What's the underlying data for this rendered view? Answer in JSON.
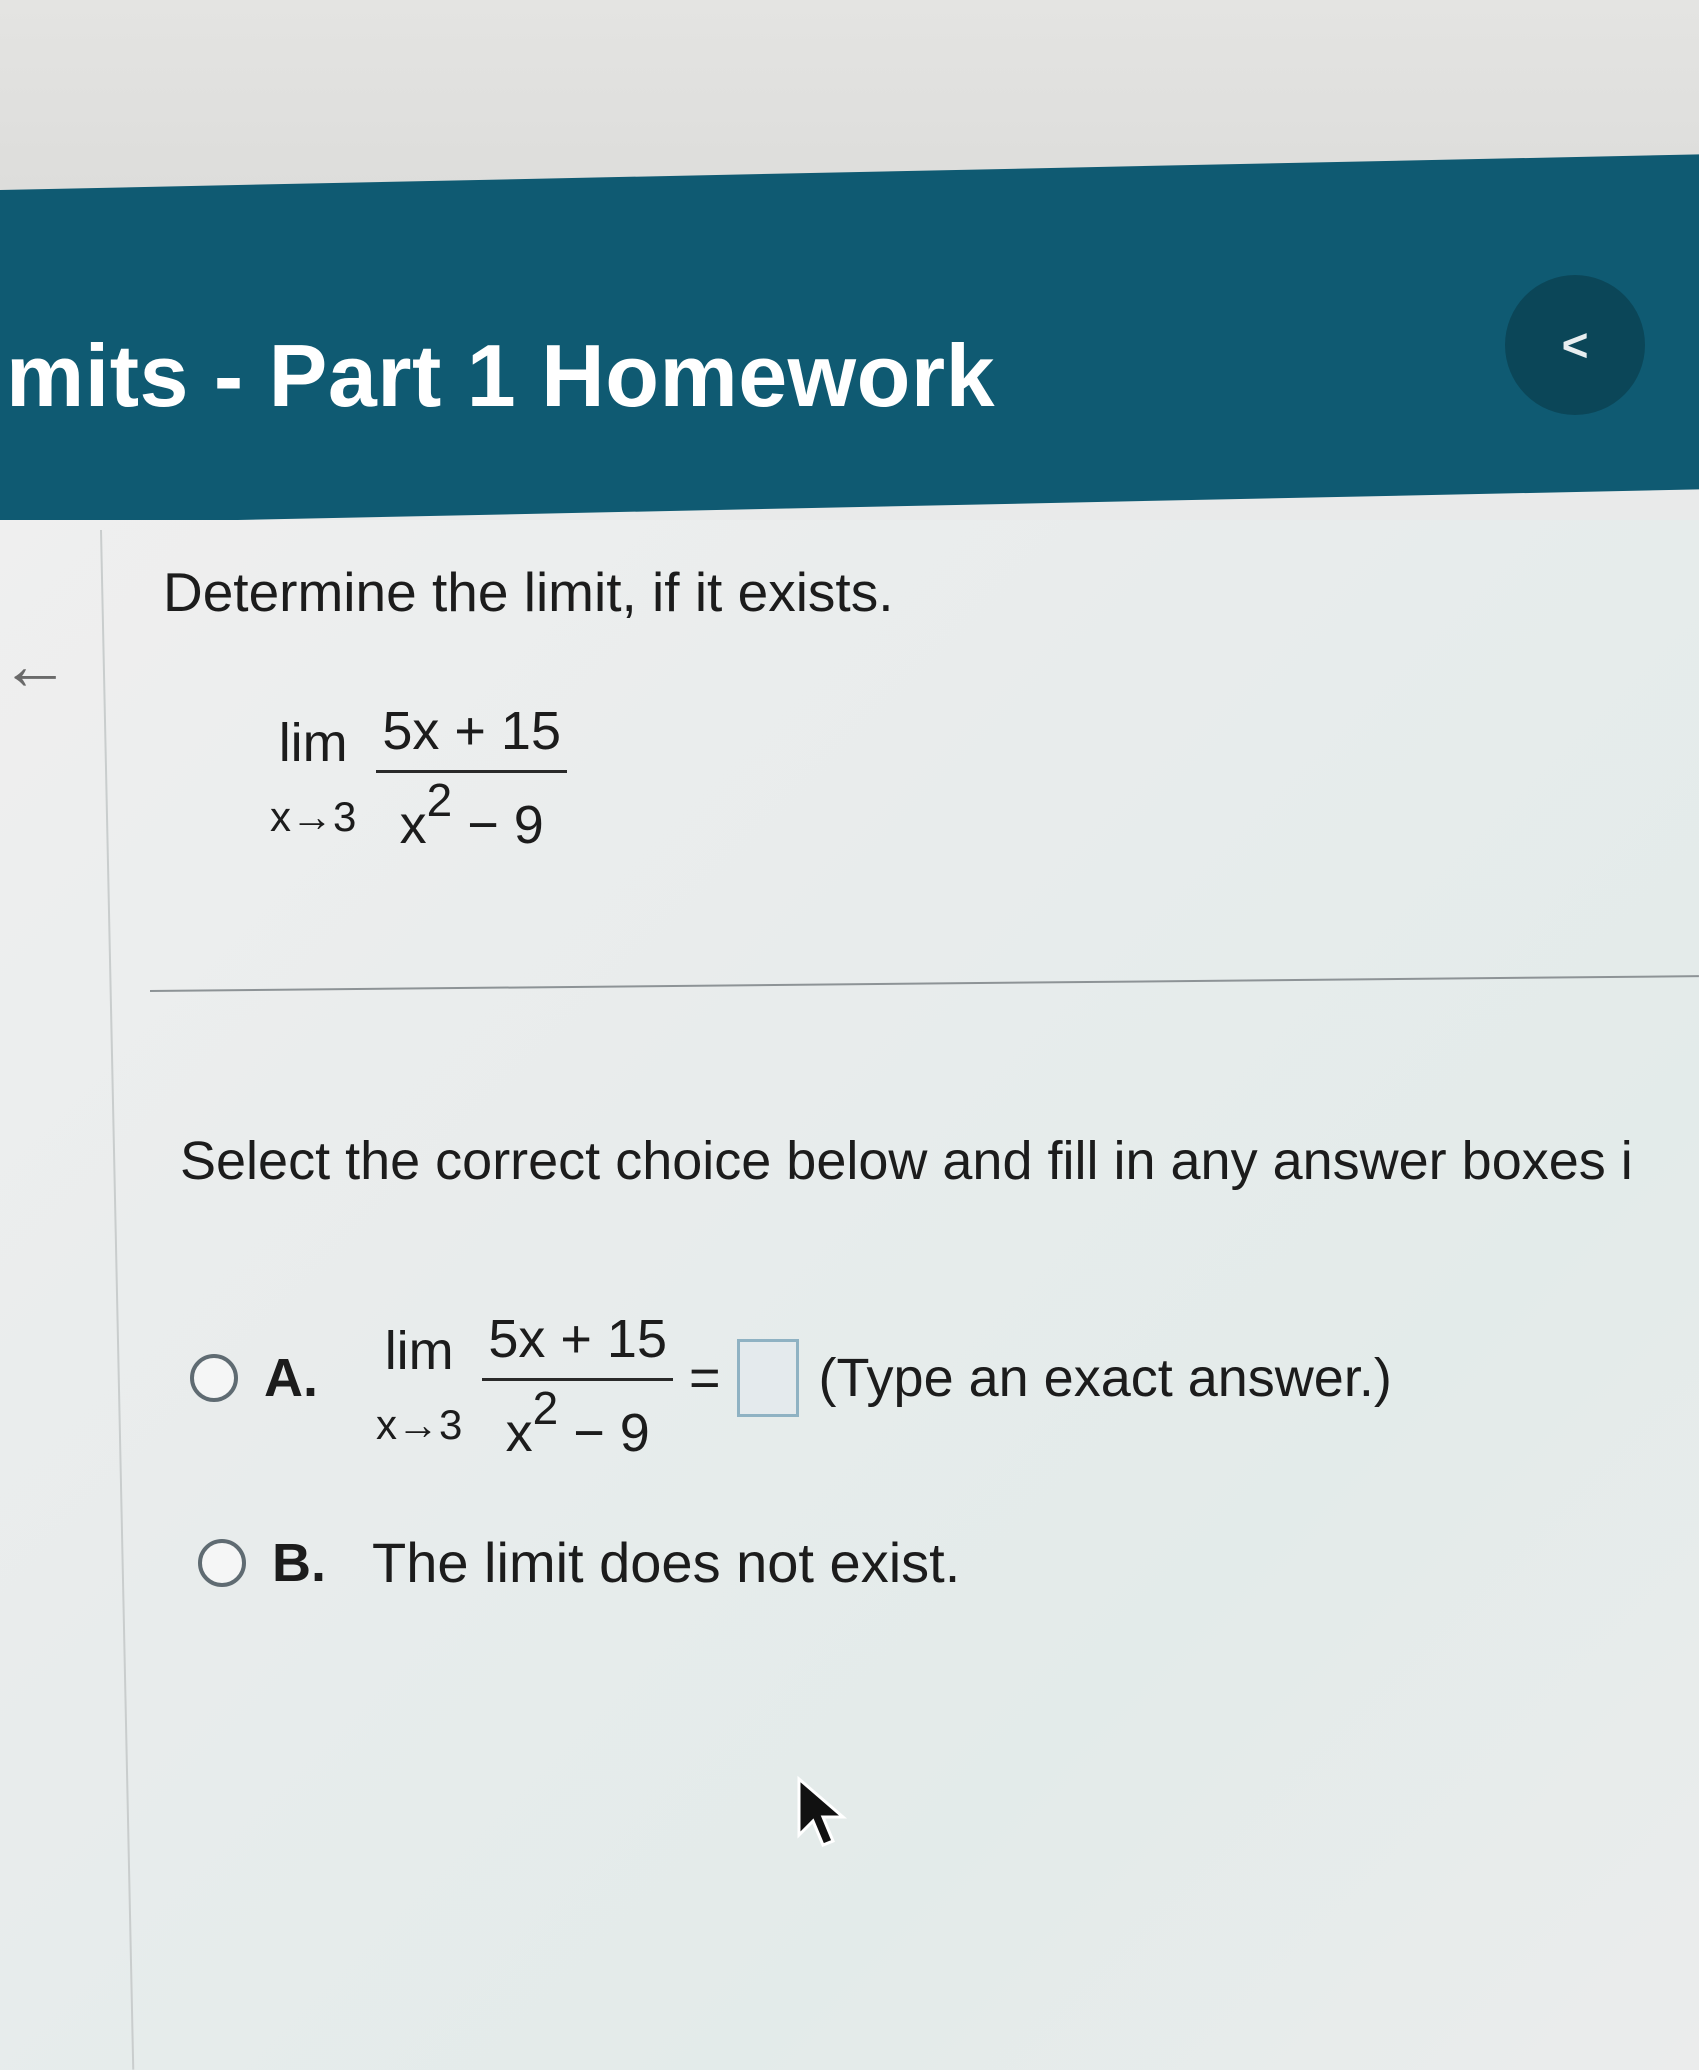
{
  "header": {
    "title": "mits - Part 1 Homework",
    "back_icon": "chevron-left-icon",
    "back_glyph": "<"
  },
  "side": {
    "collapse_glyph": "←"
  },
  "question": {
    "prompt": "Determine the limit, if it exists.",
    "expression": {
      "lim": "lim",
      "approach": "x→3",
      "numerator": "5x + 15",
      "denominator_base": "x",
      "denominator_exp": "2",
      "denominator_rest": " − 9"
    }
  },
  "instructions": "Select the correct choice below and fill in any answer boxes i",
  "choices": [
    {
      "letter": "A.",
      "expression": {
        "lim": "lim",
        "approach": "x→3",
        "numerator": "5x + 15",
        "denominator_base": "x",
        "denominator_exp": "2",
        "denominator_rest": " − 9"
      },
      "equals": "=",
      "answer_value": "",
      "hint": "(Type an exact answer.)"
    },
    {
      "letter": "B.",
      "text": "The limit does not exist."
    }
  ],
  "colors": {
    "header_bg": "#0f5a72",
    "back_button_bg": "#0b4658",
    "radio_border": "#5f6b72",
    "answer_box_border": "#8fb2c3"
  }
}
